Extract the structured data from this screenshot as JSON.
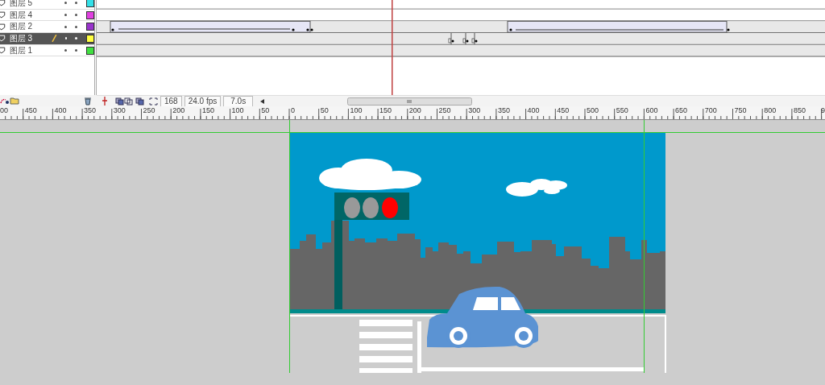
{
  "timeline": {
    "layers": [
      {
        "name": "图层 5",
        "selected": false,
        "color": "#33e0e8"
      },
      {
        "name": "图层 4",
        "selected": false,
        "color": "#e040e0"
      },
      {
        "name": "图层 2",
        "selected": false,
        "color": "#9933cc"
      },
      {
        "name": "图层 3",
        "selected": true,
        "color": "#ffff40"
      },
      {
        "name": "图层 1",
        "selected": false,
        "color": "#40e040"
      }
    ],
    "current_frame": "168",
    "frame_rate": "24.0 fps",
    "elapsed_time": "7.0s"
  },
  "ruler": {
    "labels": [
      "00",
      "450",
      "400",
      "350",
      "300",
      "250",
      "200",
      "150",
      "100",
      "50",
      "0",
      "50",
      "100",
      "150",
      "200",
      "250",
      "300",
      "350",
      "400",
      "450",
      "500",
      "550",
      "600",
      "650",
      "700",
      "750",
      "800",
      "850",
      "9"
    ]
  }
}
